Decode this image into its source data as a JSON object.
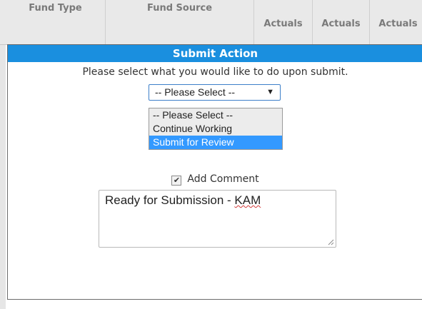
{
  "background_table": {
    "headers": {
      "fund_type": "Fund Type",
      "fund_source": "Fund Source",
      "actuals_1": "Actuals",
      "actuals_2": "Actuals",
      "actuals_3": "Actuals"
    }
  },
  "dialog": {
    "title": "Submit Action",
    "prompt": "Please select what you would like to do upon submit.",
    "select": {
      "value": "-- Please Select --",
      "arrow": "▼",
      "options": [
        "-- Please Select --",
        "Continue Working",
        "Submit for Review"
      ],
      "highlighted": "Submit for Review"
    },
    "add_comment": {
      "checked": true,
      "check_glyph": "✔",
      "label": "Add Comment"
    },
    "comment": {
      "text_main": "Ready for Submission - ",
      "text_initials": "KAM"
    }
  },
  "colors": {
    "title_bar": "#1a8fdf",
    "highlight": "#3399ff",
    "select_border": "#3d7fc9"
  }
}
